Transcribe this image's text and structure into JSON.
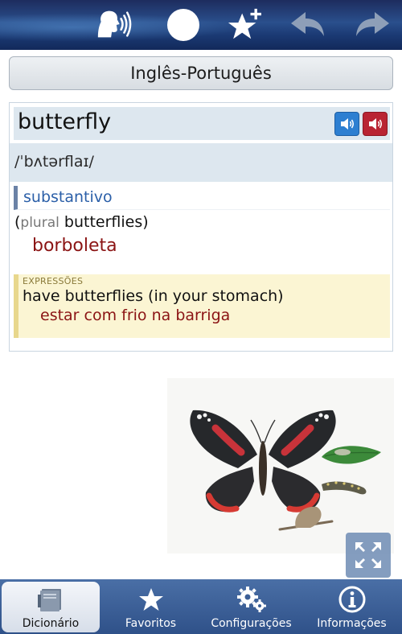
{
  "toolbar": {
    "icons": [
      "speak-icon",
      "record-icon",
      "add-favorite-icon",
      "back-icon",
      "forward-icon"
    ]
  },
  "language_header": {
    "title": "Inglês-Português"
  },
  "entry": {
    "headword": "butterfly",
    "pronunciation": "/ˈbʌtərflaɪ/",
    "part_of_speech": "substantivo",
    "plural_open": "(",
    "plural_label": "plural",
    "plural_form": "butterflies",
    "plural_close": ")",
    "translation": "borboleta",
    "expressions": {
      "label": "EXPRESSÕES",
      "phrase": "have butterflies (in your stomach)",
      "translation": "estar com frio na barriga"
    }
  },
  "tabs": [
    {
      "label": "Dicionário",
      "icon": "book-icon",
      "active": true
    },
    {
      "label": "Favoritos",
      "icon": "star-icon",
      "active": false
    },
    {
      "label": "Configurações",
      "icon": "gears-icon",
      "active": false
    },
    {
      "label": "Informações",
      "icon": "info-icon",
      "active": false
    }
  ],
  "colors": {
    "toolbar": "#1d2c5e",
    "tabbar": "#3a5d96",
    "translation": "#8b1414",
    "pos": "#2b5fa8",
    "audio_us": "#2d7fd1",
    "audio_uk": "#b92433"
  }
}
